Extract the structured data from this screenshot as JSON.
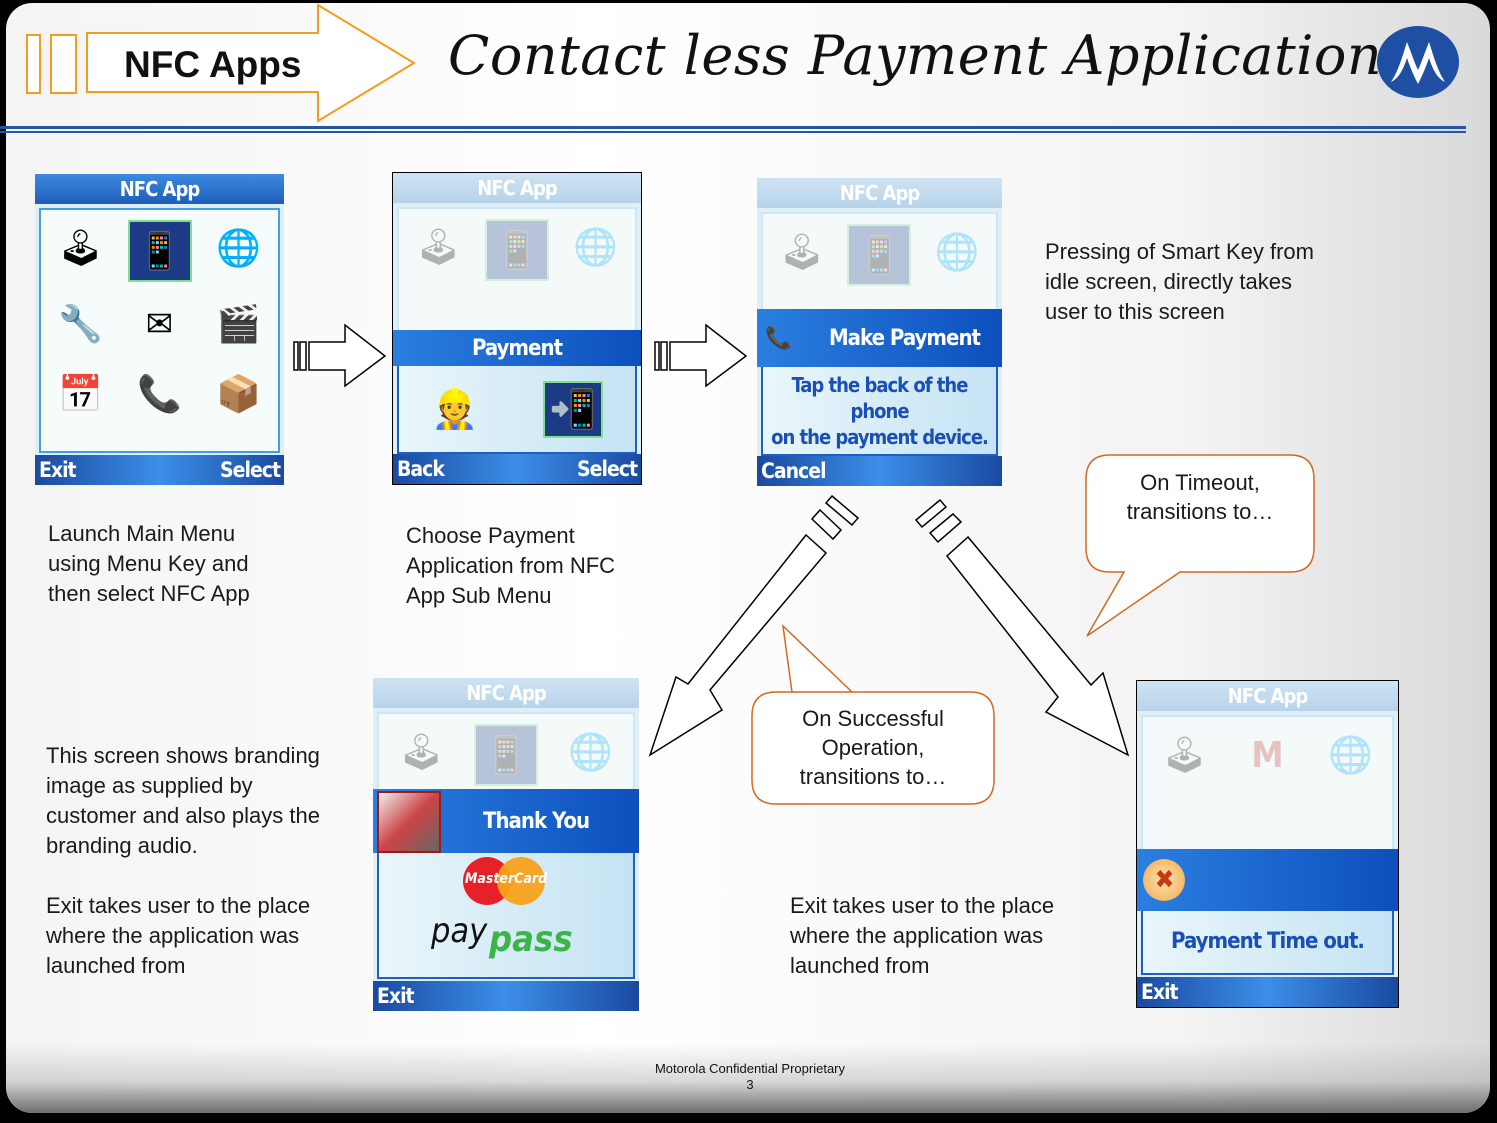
{
  "header": {
    "section_tag": "NFC Apps",
    "title": "Contact less Payment Application",
    "logo": "motorola-batwing-logo"
  },
  "colors": {
    "header_rule": "#2456a6",
    "tag_outline": "#f39c1e",
    "callout_outline": "#d2691e",
    "softkey_blue": "#1e5db8",
    "dialog_text_blue": "#1a4fb8",
    "logo_blue": "#1f4fa3"
  },
  "screens": {
    "main_menu": {
      "title": "NFC App",
      "softkey_left": "Exit",
      "softkey_right": "Select",
      "icons": [
        "games-joystick-icon",
        "phone-nfc-icon",
        "web-globe-icon",
        "settings-tools-icon",
        "messages-envelope-icon",
        "media-video-icon",
        "organizer-calendar-icon",
        "contacts-phonebook-icon",
        "my-stuff-box-icon"
      ],
      "selected_icon": "phone-nfc-icon",
      "caption": [
        "Launch Main Menu",
        "using Menu Key and",
        "then select NFC App"
      ]
    },
    "payment_submenu": {
      "title": "NFC App",
      "dialog_title": "Payment",
      "icons": [
        "person-icon",
        "phone-sparkle-icon"
      ],
      "softkey_left": "Back",
      "softkey_right": "Select",
      "caption": [
        "Choose Payment",
        "Application from NFC",
        "App Sub Menu"
      ]
    },
    "make_payment": {
      "title": "NFC App",
      "dialog_title": "Make Payment",
      "dialog_lines": [
        "Tap the back of the phone",
        "on the payment device."
      ],
      "softkey_left": "Cancel",
      "caption": [
        "Pressing of Smart Key from",
        "idle screen, directly takes",
        "user to this screen"
      ]
    },
    "thank_you": {
      "title": "NFC App",
      "dialog_title": "Thank You",
      "brand_mastercard": "MasterCard",
      "brand_pay": "pay",
      "brand_pass": "pass",
      "softkey_left": "Exit",
      "caption": [
        "This screen shows branding",
        "image as supplied by",
        "customer and also plays the",
        "branding audio.",
        "",
        "Exit takes user to the place",
        "where the application was",
        "launched from"
      ]
    },
    "timeout": {
      "title": "NFC App",
      "dialog_lines": [
        "Payment Time out."
      ],
      "softkey_left": "Exit",
      "caption": [
        "Exit takes user to the place",
        "where the application was",
        "launched from"
      ]
    }
  },
  "callouts": {
    "timeout": [
      "On Timeout,",
      "transitions to…"
    ],
    "success": [
      "On Successful",
      "Operation,",
      "transitions to…"
    ]
  },
  "footer": {
    "confidential": "Motorola Confidential Proprietary",
    "page_number": "3"
  }
}
